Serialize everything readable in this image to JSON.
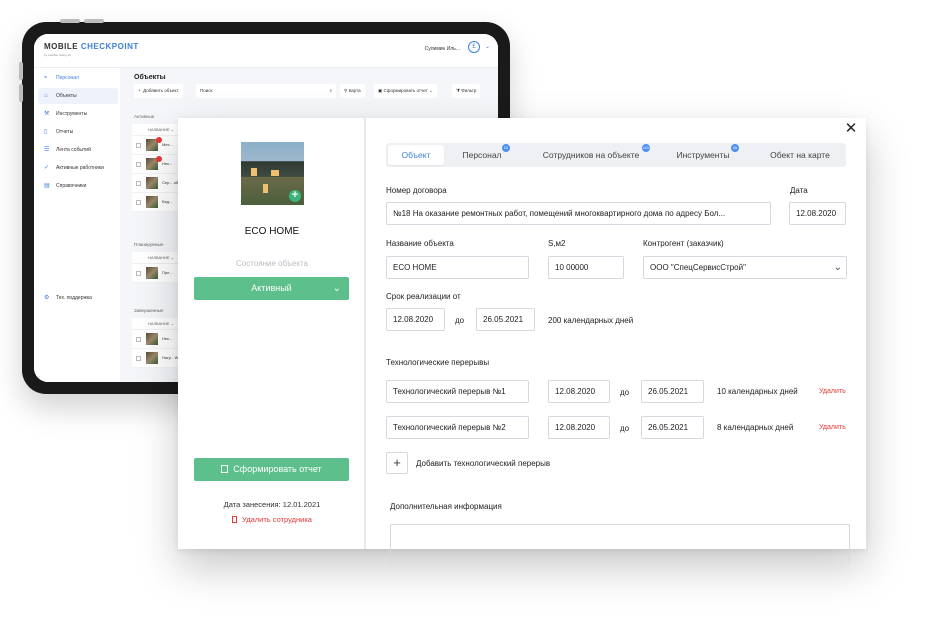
{
  "tablet": {
    "logo": "MOBILE CHECKPOINT",
    "logo_main": "MOBILE ",
    "logo_accent": "CHECKPOINT",
    "logo_sub": "by satellite.dialog.ltd",
    "user_name": "Сулимин Иль...",
    "avatar_letter": "£",
    "sidebar": [
      {
        "label": "Персонал",
        "icon": "people-icon"
      },
      {
        "label": "Объекты",
        "icon": "home-icon"
      },
      {
        "label": "Инструменты",
        "icon": "tools-icon"
      },
      {
        "label": "Отчеты",
        "icon": "report-icon"
      },
      {
        "label": "Лента событий",
        "icon": "list-icon"
      },
      {
        "label": "Активные работники",
        "icon": "check-icon"
      },
      {
        "label": "Справочники",
        "icon": "book-icon"
      }
    ],
    "support": "Тех. поддержка",
    "title": "Объекты",
    "toolbar": {
      "add": "Добавить объект",
      "search": "Поиск",
      "map": "Карта",
      "report": "Сформировать отчет",
      "filter": "Фильтр"
    },
    "sections": {
      "active": "Активные",
      "planned": "Планируемые",
      "finished": "Завершенные"
    },
    "col_head": "НАЗВАНИЕ",
    "rows_active": [
      "Мех...",
      "Нек...",
      "Сер... объ...",
      "Бед..."
    ],
    "rows_planned": [
      "Пре..."
    ],
    "rows_finished": [
      "Нек...",
      "Нагу... Wre..."
    ]
  },
  "modal": {
    "object_name": "ECO HOME",
    "state_label": "Состояние объекта",
    "state_value": "Активный",
    "report_button": "Сформировать отчет",
    "entry_date": "Дата занесения: 12.01.2021",
    "delete_employee": "Удалить сотрудника",
    "tabs": [
      {
        "label": "Объект",
        "count": ""
      },
      {
        "label": "Персонал",
        "count": "12"
      },
      {
        "label": "Сотрудников на объекте",
        "count": "110"
      },
      {
        "label": "Инструменты",
        "count": "26"
      },
      {
        "label": "Обект на карте",
        "count": ""
      }
    ],
    "contract_label": "Номер договора",
    "contract_value": "№18 На оказание ремонтных работ, помещений многоквартирного дома по адресу Бол...",
    "date_label": "Дата",
    "date_value": "12.08.2020",
    "name_label": "Название объекта",
    "name_value": "ECO HOME",
    "area_label": "S,м2",
    "area_value": "10 00000",
    "contractor_label": "Контрогент (заказчик)",
    "contractor_value": "ООО \"СпецСервисСтрой\"",
    "term_label": "Срок реализации от",
    "term_from": "12.08.2020",
    "term_to_label": "до",
    "term_to": "26.05.2021",
    "term_days": "200 календарных дней",
    "breaks_label": "Технологические перерывы",
    "breaks": [
      {
        "name": "Технологический перерыв №1",
        "from": "12.08.2020",
        "to": "26.05.2021",
        "days": "10 календарных дней",
        "delete": "Удалить"
      },
      {
        "name": "Технологический перерыв №2",
        "from": "12.08.2020",
        "to": "26.05.2021",
        "days": "8 календарных дней",
        "delete": "Удалить"
      }
    ],
    "break_to_label": "до",
    "add_break": "Добавить технологический перерыв",
    "extra_label": "Дополнительная информация"
  }
}
